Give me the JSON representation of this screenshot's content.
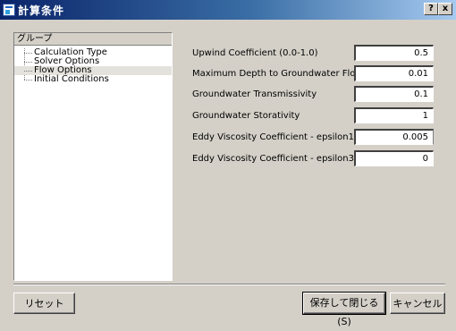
{
  "window": {
    "title": "計算条件",
    "help_label": "?",
    "close_label": "x"
  },
  "tree": {
    "header": "グループ",
    "items": [
      {
        "label": "Calculation Type",
        "selected": false
      },
      {
        "label": "Solver Options",
        "selected": false
      },
      {
        "label": "Flow Options",
        "selected": true
      },
      {
        "label": "Initial Conditions",
        "selected": false
      }
    ]
  },
  "fields": [
    {
      "label": "Upwind Coefficient (0.0-1.0)",
      "value": "0.5"
    },
    {
      "label": "Maximum Depth to Groundwater Flow",
      "value": "0.01"
    },
    {
      "label": "Groundwater Transmissivity",
      "value": "0.1"
    },
    {
      "label": "Groundwater Storativity",
      "value": "1"
    },
    {
      "label": "Eddy Viscosity Coefficient - epsilon1",
      "value": "0.005"
    },
    {
      "label": "Eddy Viscosity Coefficient - epsilon3",
      "value": "0"
    }
  ],
  "buttons": {
    "reset": "リセット",
    "save_close": "保存して閉じる(S)",
    "cancel": "キャンセル"
  }
}
